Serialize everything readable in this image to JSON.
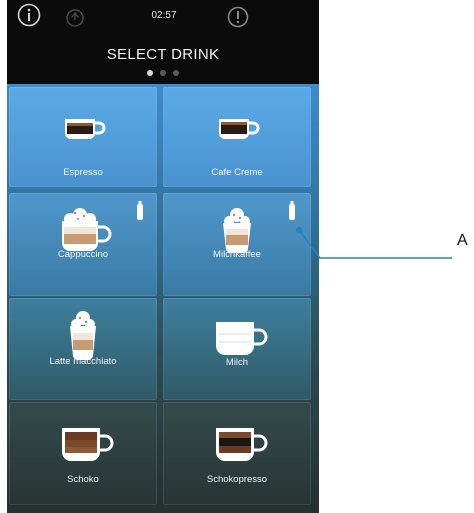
{
  "status": {
    "time": "02:57"
  },
  "header": {
    "title": "SELECT DRINK"
  },
  "pager": {
    "pages": 3,
    "active": 0
  },
  "drinks": [
    {
      "label": "Espresso"
    },
    {
      "label": "Cafe Creme"
    },
    {
      "label": "Cappuccino"
    },
    {
      "label": "Milchkaffee"
    },
    {
      "label": "Latte macchiato"
    },
    {
      "label": "Milch"
    },
    {
      "label": "Schoko"
    },
    {
      "label": "Schokopresso"
    }
  ],
  "callout": {
    "label": "A"
  },
  "colors": {
    "tile_top": "#5aa6e6",
    "tile_bottom": "#2e3a38",
    "line": "#2a7fc0"
  }
}
